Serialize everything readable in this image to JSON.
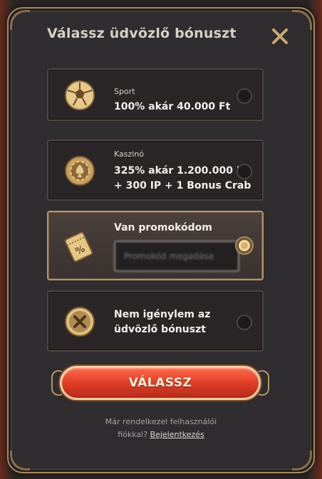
{
  "modal": {
    "title": "Válassz üdvözlő bónuszt",
    "close_icon": "close-icon"
  },
  "options": [
    {
      "category": "Sport",
      "title_line1": "100% akár 40.000 Ft",
      "title_line2": "",
      "icon": "football-icon",
      "selected": false
    },
    {
      "category": "Kaszinó",
      "title_line1": "325% akár 1.200.000 Ft",
      "title_line2": "+ 300 IP + 1 Bonus Crab",
      "icon": "casino-chip-icon",
      "selected": false
    },
    {
      "category": "",
      "title_line1": "Van promokódom",
      "title_line2": "",
      "icon": "ticket-icon",
      "selected": true,
      "input_placeholder": "Promokód megadása"
    },
    {
      "category": "",
      "title_line1": "Nem igénylem az",
      "title_line2": "üdvözlő bónuszt",
      "icon": "no-bonus-icon",
      "selected": false
    }
  ],
  "cta": {
    "label": "VÁLASSZ"
  },
  "footer": {
    "line1": "Már rendelkezel felhasználói",
    "line2_prefix": "fiókkal?",
    "login_link": "Bejelentkezés"
  },
  "colors": {
    "accent_gold": "#c9a96e",
    "cta_red": "#e2412a",
    "panel": "#2f2d2f"
  }
}
